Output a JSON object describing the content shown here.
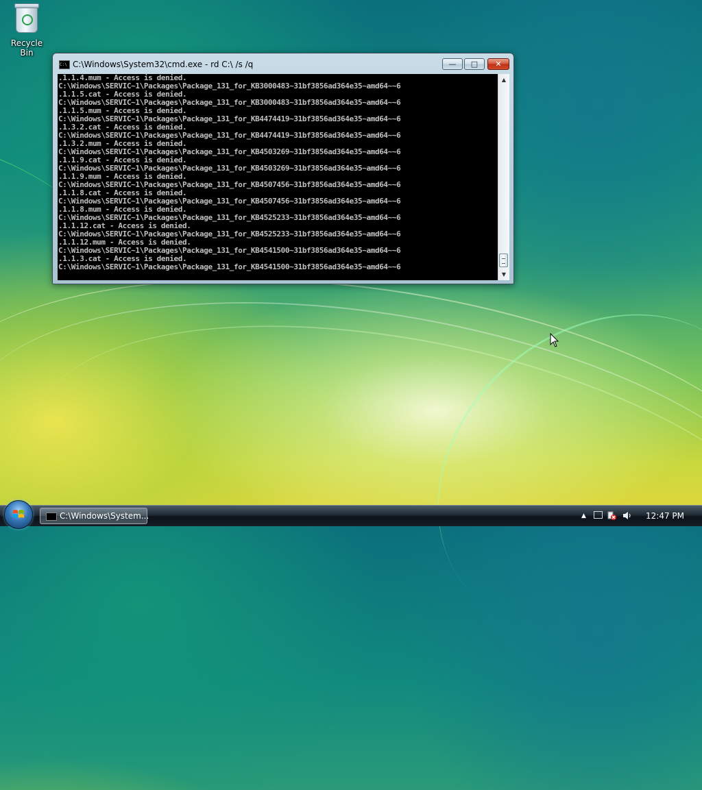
{
  "desktop": {
    "recycle_bin_label": "Recycle Bin"
  },
  "window": {
    "title": "C:\\Windows\\System32\\cmd.exe - rd  C:\\ /s /q",
    "title_icon_text": "C:\\",
    "buttons": {
      "minimize": "—",
      "maximize": "□",
      "close": "✕"
    }
  },
  "console": {
    "lines": [
      ".1.1.4.mum - Access is denied.",
      "C:\\Windows\\SERVIC~1\\Packages\\Package_131_for_KB3000483~31bf3856ad364e35~amd64~~6",
      ".1.1.5.cat - Access is denied.",
      "C:\\Windows\\SERVIC~1\\Packages\\Package_131_for_KB3000483~31bf3856ad364e35~amd64~~6",
      ".1.1.5.mum - Access is denied.",
      "C:\\Windows\\SERVIC~1\\Packages\\Package_131_for_KB4474419~31bf3856ad364e35~amd64~~6",
      ".1.3.2.cat - Access is denied.",
      "C:\\Windows\\SERVIC~1\\Packages\\Package_131_for_KB4474419~31bf3856ad364e35~amd64~~6",
      ".1.3.2.mum - Access is denied.",
      "C:\\Windows\\SERVIC~1\\Packages\\Package_131_for_KB4503269~31bf3856ad364e35~amd64~~6",
      ".1.1.9.cat - Access is denied.",
      "C:\\Windows\\SERVIC~1\\Packages\\Package_131_for_KB4503269~31bf3856ad364e35~amd64~~6",
      ".1.1.9.mum - Access is denied.",
      "C:\\Windows\\SERVIC~1\\Packages\\Package_131_for_KB4507456~31bf3856ad364e35~amd64~~6",
      ".1.1.8.cat - Access is denied.",
      "C:\\Windows\\SERVIC~1\\Packages\\Package_131_for_KB4507456~31bf3856ad364e35~amd64~~6",
      ".1.1.8.mum - Access is denied.",
      "C:\\Windows\\SERVIC~1\\Packages\\Package_131_for_KB4525233~31bf3856ad364e35~amd64~~6",
      ".1.1.12.cat - Access is denied.",
      "C:\\Windows\\SERVIC~1\\Packages\\Package_131_for_KB4525233~31bf3856ad364e35~amd64~~6",
      ".1.1.12.mum - Access is denied.",
      "C:\\Windows\\SERVIC~1\\Packages\\Package_131_for_KB4541500~31bf3856ad364e35~amd64~~6",
      ".1.1.3.cat - Access is denied.",
      "C:\\Windows\\SERVIC~1\\Packages\\Package_131_for_KB4541500~31bf3856ad364e35~amd64~~6"
    ],
    "text_color": "#c0c0c0",
    "background_color": "#000000"
  },
  "taskbar": {
    "task_label": "C:\\Windows\\System...",
    "clock": "12:47 PM",
    "icons": [
      "start-orb-icon",
      "show-hidden-icons",
      "network-icon",
      "security-icon",
      "volume-icon"
    ]
  }
}
